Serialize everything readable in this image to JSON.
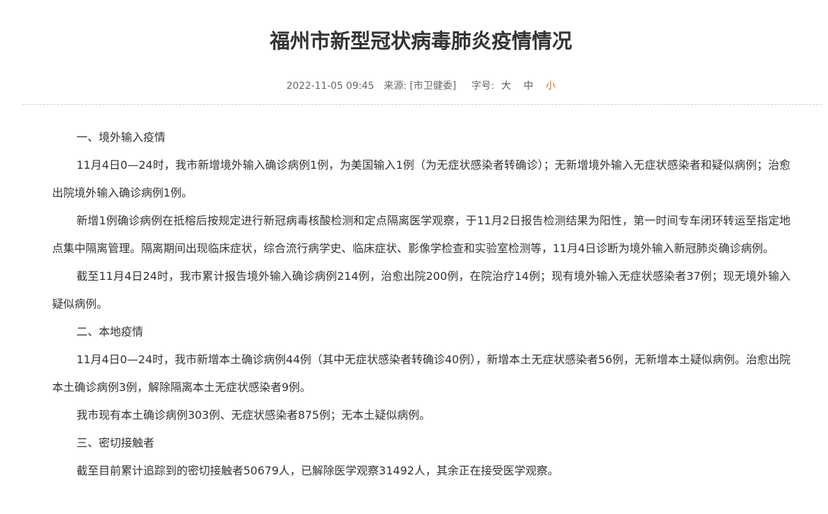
{
  "article": {
    "title": "福州市新型冠状病毒肺炎疫情情况",
    "meta": {
      "date": "2022-11-05 09:45",
      "source_label": "来源:",
      "source_value": "[市卫健委]",
      "font_size_label": "字号:",
      "font_size_options": [
        "大",
        "中",
        "小"
      ],
      "font_size_selected": "小",
      "accent_color": "#e06b1f"
    },
    "paragraphs": [
      "一、境外输入疫情",
      "11月4日0—24时，我市新增境外输入确诊病例1例，为美国输入1例（为无症状感染者转确诊）；无新增境外输入无症状感染者和疑似病例；治愈出院境外输入确诊病例1例。",
      "新增1例确诊病例在抵榕后按规定进行新冠病毒核酸检测和定点隔离医学观察，于11月2日报告检测结果为阳性，第一时间专车闭环转运至指定地点集中隔离管理。隔离期间出现临床症状，综合流行病学史、临床症状、影像学检查和实验室检测等，11月4日诊断为境外输入新冠肺炎确诊病例。",
      "截至11月4日24时，我市累计报告境外输入确诊病例214例，治愈出院200例，在院治疗14例；现有境外输入无症状感染者37例；现无境外输入疑似病例。",
      "二、本地疫情",
      "11月4日0—24时，我市新增本土确诊病例44例（其中无症状感染者转确诊40例），新增本土无症状感染者56例，无新增本土疑似病例。治愈出院本土确诊病例3例，解除隔离本土无症状感染者9例。",
      "我市现有本土确诊病例303例、无症状感染者875例；无本土疑似病例。",
      "三、密切接触者",
      "截至目前累计追踪到的密切接触者50679人，已解除医学观察31492人，其余正在接受医学观察。"
    ]
  }
}
